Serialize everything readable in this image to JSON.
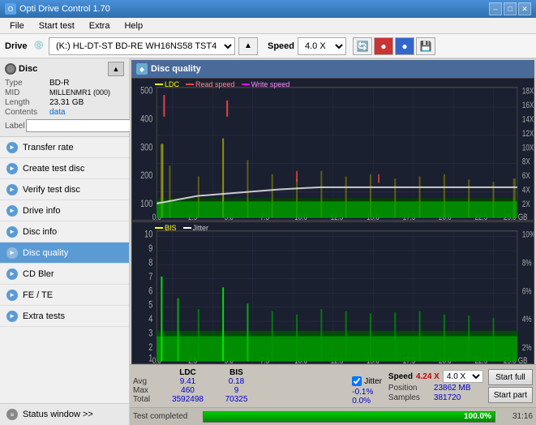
{
  "app": {
    "title": "Opti Drive Control 1.70",
    "minimize_label": "–",
    "maximize_label": "□",
    "close_label": "✕"
  },
  "menu": {
    "items": [
      "File",
      "Start test",
      "Extra",
      "Help"
    ]
  },
  "drive_bar": {
    "label": "Drive",
    "drive_value": "(K:)  HL-DT-ST BD-RE  WH16NS58 TST4",
    "speed_label": "Speed",
    "speed_value": "4.0 X"
  },
  "disc": {
    "header": "Disc",
    "type_label": "Type",
    "type_value": "BD-R",
    "mid_label": "MID",
    "mid_value": "MILLENMR1 (000)",
    "length_label": "Length",
    "length_value": "23.31 GB",
    "contents_label": "Contents",
    "contents_value": "data",
    "label_label": "Label",
    "label_placeholder": ""
  },
  "nav": {
    "items": [
      {
        "id": "transfer-rate",
        "label": "Transfer rate",
        "icon": "►"
      },
      {
        "id": "create-test-disc",
        "label": "Create test disc",
        "icon": "►"
      },
      {
        "id": "verify-test-disc",
        "label": "Verify test disc",
        "icon": "►"
      },
      {
        "id": "drive-info",
        "label": "Drive info",
        "icon": "►"
      },
      {
        "id": "disc-info",
        "label": "Disc info",
        "icon": "►"
      },
      {
        "id": "disc-quality",
        "label": "Disc quality",
        "icon": "►",
        "active": true
      },
      {
        "id": "cd-bler",
        "label": "CD Bler",
        "icon": "►"
      },
      {
        "id": "fe-te",
        "label": "FE / TE",
        "icon": "►"
      },
      {
        "id": "extra-tests",
        "label": "Extra tests",
        "icon": "►"
      }
    ],
    "status_window_label": "Status window >>"
  },
  "disc_quality": {
    "title": "Disc quality",
    "chart1": {
      "legend": [
        {
          "id": "ldc",
          "label": "LDC",
          "color": "#ffff00"
        },
        {
          "id": "read",
          "label": "Read speed",
          "color": "#ff4444"
        },
        {
          "id": "write",
          "label": "Write speed",
          "color": "#ff00ff"
        }
      ],
      "y_max": 500,
      "y_labels": [
        "500",
        "400",
        "300",
        "200",
        "100",
        "0"
      ],
      "y_right_labels": [
        "18X",
        "16X",
        "14X",
        "12X",
        "10X",
        "8X",
        "6X",
        "4X",
        "2X"
      ],
      "x_labels": [
        "0.0",
        "2.5",
        "5.0",
        "7.5",
        "10.0",
        "12.5",
        "15.0",
        "17.5",
        "20.0",
        "22.5",
        "25.0 GB"
      ]
    },
    "chart2": {
      "legend": [
        {
          "id": "bis",
          "label": "BIS",
          "color": "#ffff00"
        },
        {
          "id": "jitter",
          "label": "Jitter",
          "color": "#ffffff"
        }
      ],
      "y_max": 10,
      "y_labels": [
        "10",
        "9",
        "8",
        "7",
        "6",
        "5",
        "4",
        "3",
        "2",
        "1"
      ],
      "y_right_labels": [
        "10%",
        "8%",
        "6%",
        "4%",
        "2%"
      ],
      "x_labels": [
        "0.0",
        "2.5",
        "5.0",
        "7.5",
        "10.0",
        "12.5",
        "15.0",
        "17.5",
        "20.0",
        "22.5",
        "25.0 GB"
      ]
    },
    "stats": {
      "col_headers": [
        "",
        "LDC",
        "BIS",
        "",
        "Jitter",
        "Speed"
      ],
      "avg_label": "Avg",
      "avg_ldc": "9.41",
      "avg_bis": "0.18",
      "avg_jitter": "-0.1%",
      "max_label": "Max",
      "max_ldc": "460",
      "max_bis": "9",
      "max_jitter": "0.0%",
      "total_label": "Total",
      "total_ldc": "3592498",
      "total_bis": "70325",
      "speed_display": "4.24 X",
      "speed_dropdown": "4.0 X",
      "position_label": "Position",
      "position_value": "23862 MB",
      "samples_label": "Samples",
      "samples_value": "381720",
      "start_full_label": "Start full",
      "start_part_label": "Start part",
      "jitter_checked": true,
      "jitter_label": "Jitter"
    }
  },
  "progress": {
    "label": "Test completed",
    "percent": 100,
    "percent_display": "100.0%",
    "time": "31:16"
  },
  "colors": {
    "accent_blue": "#5b9bd5",
    "active_nav": "#5b9bd5",
    "chart_bg": "#1a2030",
    "green_bar": "#00cc00",
    "data_blue": "#0000cc"
  }
}
